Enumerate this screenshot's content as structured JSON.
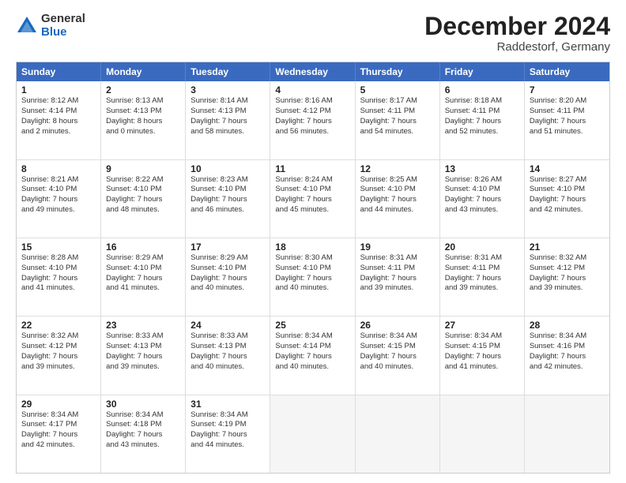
{
  "logo": {
    "general": "General",
    "blue": "Blue"
  },
  "title": "December 2024",
  "location": "Raddestorf, Germany",
  "headers": [
    "Sunday",
    "Monday",
    "Tuesday",
    "Wednesday",
    "Thursday",
    "Friday",
    "Saturday"
  ],
  "weeks": [
    [
      {
        "day": "1",
        "lines": [
          "Sunrise: 8:12 AM",
          "Sunset: 4:14 PM",
          "Daylight: 8 hours",
          "and 2 minutes."
        ]
      },
      {
        "day": "2",
        "lines": [
          "Sunrise: 8:13 AM",
          "Sunset: 4:13 PM",
          "Daylight: 8 hours",
          "and 0 minutes."
        ]
      },
      {
        "day": "3",
        "lines": [
          "Sunrise: 8:14 AM",
          "Sunset: 4:13 PM",
          "Daylight: 7 hours",
          "and 58 minutes."
        ]
      },
      {
        "day": "4",
        "lines": [
          "Sunrise: 8:16 AM",
          "Sunset: 4:12 PM",
          "Daylight: 7 hours",
          "and 56 minutes."
        ]
      },
      {
        "day": "5",
        "lines": [
          "Sunrise: 8:17 AM",
          "Sunset: 4:11 PM",
          "Daylight: 7 hours",
          "and 54 minutes."
        ]
      },
      {
        "day": "6",
        "lines": [
          "Sunrise: 8:18 AM",
          "Sunset: 4:11 PM",
          "Daylight: 7 hours",
          "and 52 minutes."
        ]
      },
      {
        "day": "7",
        "lines": [
          "Sunrise: 8:20 AM",
          "Sunset: 4:11 PM",
          "Daylight: 7 hours",
          "and 51 minutes."
        ]
      }
    ],
    [
      {
        "day": "8",
        "lines": [
          "Sunrise: 8:21 AM",
          "Sunset: 4:10 PM",
          "Daylight: 7 hours",
          "and 49 minutes."
        ]
      },
      {
        "day": "9",
        "lines": [
          "Sunrise: 8:22 AM",
          "Sunset: 4:10 PM",
          "Daylight: 7 hours",
          "and 48 minutes."
        ]
      },
      {
        "day": "10",
        "lines": [
          "Sunrise: 8:23 AM",
          "Sunset: 4:10 PM",
          "Daylight: 7 hours",
          "and 46 minutes."
        ]
      },
      {
        "day": "11",
        "lines": [
          "Sunrise: 8:24 AM",
          "Sunset: 4:10 PM",
          "Daylight: 7 hours",
          "and 45 minutes."
        ]
      },
      {
        "day": "12",
        "lines": [
          "Sunrise: 8:25 AM",
          "Sunset: 4:10 PM",
          "Daylight: 7 hours",
          "and 44 minutes."
        ]
      },
      {
        "day": "13",
        "lines": [
          "Sunrise: 8:26 AM",
          "Sunset: 4:10 PM",
          "Daylight: 7 hours",
          "and 43 minutes."
        ]
      },
      {
        "day": "14",
        "lines": [
          "Sunrise: 8:27 AM",
          "Sunset: 4:10 PM",
          "Daylight: 7 hours",
          "and 42 minutes."
        ]
      }
    ],
    [
      {
        "day": "15",
        "lines": [
          "Sunrise: 8:28 AM",
          "Sunset: 4:10 PM",
          "Daylight: 7 hours",
          "and 41 minutes."
        ]
      },
      {
        "day": "16",
        "lines": [
          "Sunrise: 8:29 AM",
          "Sunset: 4:10 PM",
          "Daylight: 7 hours",
          "and 41 minutes."
        ]
      },
      {
        "day": "17",
        "lines": [
          "Sunrise: 8:29 AM",
          "Sunset: 4:10 PM",
          "Daylight: 7 hours",
          "and 40 minutes."
        ]
      },
      {
        "day": "18",
        "lines": [
          "Sunrise: 8:30 AM",
          "Sunset: 4:10 PM",
          "Daylight: 7 hours",
          "and 40 minutes."
        ]
      },
      {
        "day": "19",
        "lines": [
          "Sunrise: 8:31 AM",
          "Sunset: 4:11 PM",
          "Daylight: 7 hours",
          "and 39 minutes."
        ]
      },
      {
        "day": "20",
        "lines": [
          "Sunrise: 8:31 AM",
          "Sunset: 4:11 PM",
          "Daylight: 7 hours",
          "and 39 minutes."
        ]
      },
      {
        "day": "21",
        "lines": [
          "Sunrise: 8:32 AM",
          "Sunset: 4:12 PM",
          "Daylight: 7 hours",
          "and 39 minutes."
        ]
      }
    ],
    [
      {
        "day": "22",
        "lines": [
          "Sunrise: 8:32 AM",
          "Sunset: 4:12 PM",
          "Daylight: 7 hours",
          "and 39 minutes."
        ]
      },
      {
        "day": "23",
        "lines": [
          "Sunrise: 8:33 AM",
          "Sunset: 4:13 PM",
          "Daylight: 7 hours",
          "and 39 minutes."
        ]
      },
      {
        "day": "24",
        "lines": [
          "Sunrise: 8:33 AM",
          "Sunset: 4:13 PM",
          "Daylight: 7 hours",
          "and 40 minutes."
        ]
      },
      {
        "day": "25",
        "lines": [
          "Sunrise: 8:34 AM",
          "Sunset: 4:14 PM",
          "Daylight: 7 hours",
          "and 40 minutes."
        ]
      },
      {
        "day": "26",
        "lines": [
          "Sunrise: 8:34 AM",
          "Sunset: 4:15 PM",
          "Daylight: 7 hours",
          "and 40 minutes."
        ]
      },
      {
        "day": "27",
        "lines": [
          "Sunrise: 8:34 AM",
          "Sunset: 4:15 PM",
          "Daylight: 7 hours",
          "and 41 minutes."
        ]
      },
      {
        "day": "28",
        "lines": [
          "Sunrise: 8:34 AM",
          "Sunset: 4:16 PM",
          "Daylight: 7 hours",
          "and 42 minutes."
        ]
      }
    ],
    [
      {
        "day": "29",
        "lines": [
          "Sunrise: 8:34 AM",
          "Sunset: 4:17 PM",
          "Daylight: 7 hours",
          "and 42 minutes."
        ]
      },
      {
        "day": "30",
        "lines": [
          "Sunrise: 8:34 AM",
          "Sunset: 4:18 PM",
          "Daylight: 7 hours",
          "and 43 minutes."
        ]
      },
      {
        "day": "31",
        "lines": [
          "Sunrise: 8:34 AM",
          "Sunset: 4:19 PM",
          "Daylight: 7 hours",
          "and 44 minutes."
        ]
      },
      null,
      null,
      null,
      null
    ]
  ]
}
